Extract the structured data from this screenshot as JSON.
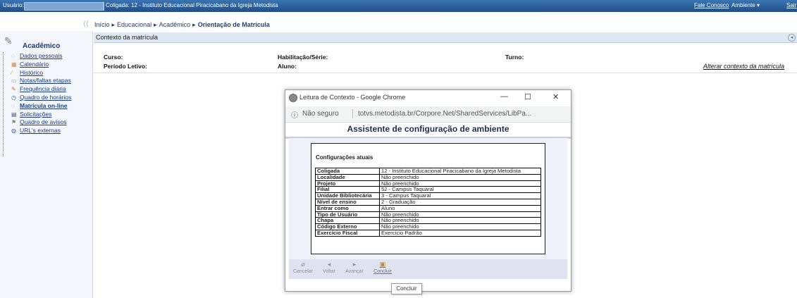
{
  "topbar": {
    "user_label": "Usuário:",
    "coligada": "Coligada: 12 - Instituto Educacional Piracicabano da Igreja Metodista",
    "contact": "Fale Conosco",
    "ambiente": "Ambiente ▾",
    "sair": "Sair"
  },
  "breadcrumb": {
    "items": [
      "Início",
      "Educacional",
      "Acadêmico"
    ],
    "current": "Orientação de Matrícula",
    "sep": "▸"
  },
  "sidebar": {
    "title": "Acadêmico",
    "items": [
      {
        "label": "Dados pessoais",
        "icon": "user-icon",
        "glyph": "◌"
      },
      {
        "label": "Calendário",
        "icon": "calendar-icon",
        "glyph": "▦"
      },
      {
        "label": "Histórico",
        "icon": "history-icon",
        "glyph": "⁄"
      },
      {
        "label": "Notas/faltas etapas",
        "icon": "grades-icon",
        "glyph": "▭"
      },
      {
        "label": "Frequência diária",
        "icon": "attendance-icon",
        "glyph": "✎"
      },
      {
        "label": "Quadro de horários",
        "icon": "clock-icon",
        "glyph": "◷"
      },
      {
        "label": "Matrícula on-line",
        "icon": "enrollment-icon",
        "glyph": "◌"
      },
      {
        "label": "Solicitações",
        "icon": "requests-icon",
        "glyph": "▤"
      },
      {
        "label": "Quadro de avisos",
        "icon": "notice-board-icon",
        "glyph": "⚑"
      },
      {
        "label": "URL's externas",
        "icon": "globe-icon",
        "glyph": "◍"
      }
    ]
  },
  "context": {
    "title": "Contexto da matrícula",
    "curso_label": "Curso:",
    "periodo_label": "Período Letivo:",
    "habilitacao_label": "Habilitação/Série:",
    "aluno_label": "Aluno:",
    "turno_label": "Turno:",
    "alter_link": "Alterar contexto da matrícula"
  },
  "popup": {
    "window_title": "Leitura de Contexto - Google Chrome",
    "btn_min": "—",
    "btn_max": "☐",
    "btn_close": "✕",
    "info_icon": "ⓘ",
    "not_secure": "Não seguro",
    "url": "totvs.metodista.br/Corpore.Net/SharedServices/LibPa...",
    "wizard_title": "Assistente de configuração de ambiente",
    "config_title": "Configurações atuais",
    "rows": [
      {
        "k": "Coligada",
        "v": "12 - Instituto Educacional Piracicabano da Igreja Metodista"
      },
      {
        "k": "Localidade",
        "v": "Não preenchido"
      },
      {
        "k": "Projeto",
        "v": "Não preenchido"
      },
      {
        "k": "Filial",
        "v": "52 - Campus Taquaral"
      },
      {
        "k": "Unidade Bibliotecária",
        "v": "3 - Campus Taquaral"
      },
      {
        "k": "Nível de ensino",
        "v": "2 - Graduação"
      },
      {
        "k": "Entrar como",
        "v": "Aluno"
      },
      {
        "k": "Tipo de Usuário",
        "v": "Não preenchido"
      },
      {
        "k": "Chapa",
        "v": "Não preenchido"
      },
      {
        "k": "Código Externo",
        "v": "Não preenchido"
      },
      {
        "k": "Exercício Fiscal",
        "v": "Exercício Padrão"
      }
    ],
    "toolbar": {
      "cancel": "Cancelar",
      "back": "Voltar",
      "next": "Avançar",
      "finish": "Concluir"
    }
  },
  "tooltip": "Concluir"
}
